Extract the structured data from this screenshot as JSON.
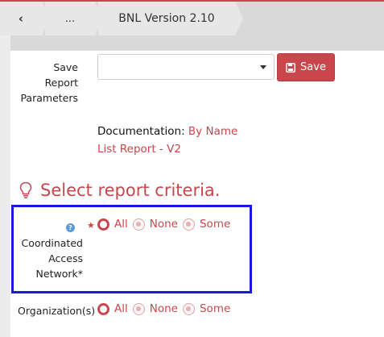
{
  "breadcrumb": {
    "back": "‹",
    "ellipsis": "...",
    "current": "BNL Version 2.10"
  },
  "save_params": {
    "label_line1": "Save",
    "label_line2": "Report",
    "label_line3": "Parameters",
    "select_value": "",
    "save_button": "Save"
  },
  "documentation": {
    "label": "Documentation:",
    "link_line1": "By Name",
    "link_line2": "List Report - V2"
  },
  "criteria": {
    "title": "Select report criteria.",
    "fields": [
      {
        "label_line1": "Coordinated",
        "label_line2": "Access",
        "label_line3": "Network*",
        "required": "★",
        "help": "?",
        "options": [
          "All",
          "None",
          "Some"
        ],
        "selected": "All"
      },
      {
        "label_line1": "Organization(s)",
        "options": [
          "All",
          "None",
          "Some"
        ],
        "selected": "All"
      }
    ]
  },
  "colors": {
    "accent": "#c9474c",
    "highlight": "#1a1adc"
  }
}
